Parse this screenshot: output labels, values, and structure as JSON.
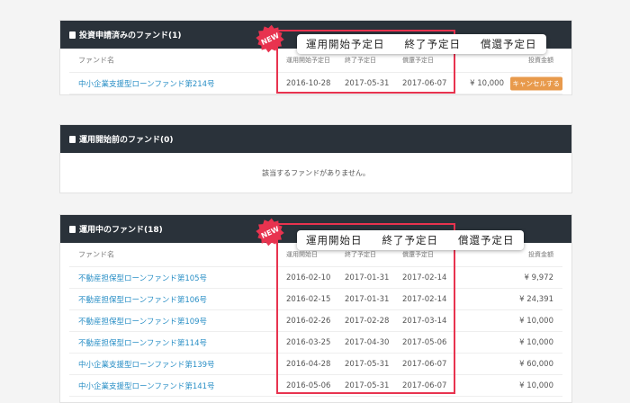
{
  "panel1": {
    "title": "投資申請済みのファンド(1)",
    "headers": [
      "ファンド名",
      "運用開始予定日",
      "終了予定日",
      "償還予定日",
      "投資金額"
    ],
    "rows": [
      {
        "name": "中小企業支援型ローンファンド第214号",
        "start": "2016-10-28",
        "end": "2017-05-31",
        "redeem": "2017-06-07",
        "amount": "¥ 10,000",
        "action": "キャンセルする"
      }
    ],
    "callout": [
      "運用開始予定日",
      "終了予定日",
      "償還予定日"
    ],
    "badge": "NEW"
  },
  "panel2": {
    "title": "運用開始前のファンド(0)",
    "empty": "該当するファンドがありません。"
  },
  "panel3": {
    "title": "運用中のファンド(18)",
    "headers": [
      "ファンド名",
      "運用開始日",
      "終了予定日",
      "償還予定日",
      "投資金額"
    ],
    "rows": [
      {
        "name": "不動産担保型ローンファンド第105号",
        "start": "2016-02-10",
        "end": "2017-01-31",
        "redeem": "2017-02-14",
        "amount": "¥ 9,972"
      },
      {
        "name": "不動産担保型ローンファンド第106号",
        "start": "2016-02-15",
        "end": "2017-01-31",
        "redeem": "2017-02-14",
        "amount": "¥ 24,391"
      },
      {
        "name": "不動産担保型ローンファンド第109号",
        "start": "2016-02-26",
        "end": "2017-02-28",
        "redeem": "2017-03-14",
        "amount": "¥ 10,000"
      },
      {
        "name": "不動産担保型ローンファンド第114号",
        "start": "2016-03-25",
        "end": "2017-04-30",
        "redeem": "2017-05-06",
        "amount": "¥ 10,000"
      },
      {
        "name": "中小企業支援型ローンファンド第139号",
        "start": "2016-04-28",
        "end": "2017-05-31",
        "redeem": "2017-06-07",
        "amount": "¥ 60,000"
      },
      {
        "name": "中小企業支援型ローンファンド第141号",
        "start": "2016-05-06",
        "end": "2017-05-31",
        "redeem": "2017-06-07",
        "amount": "¥ 10,000"
      }
    ],
    "callout": [
      "運用開始日",
      "終了予定日",
      "償還予定日"
    ],
    "badge": "NEW"
  },
  "colors": {
    "header": "#2a323a",
    "link": "#2a8fc6",
    "highlight": "#e8334f",
    "cancel": "#e89a4c"
  }
}
